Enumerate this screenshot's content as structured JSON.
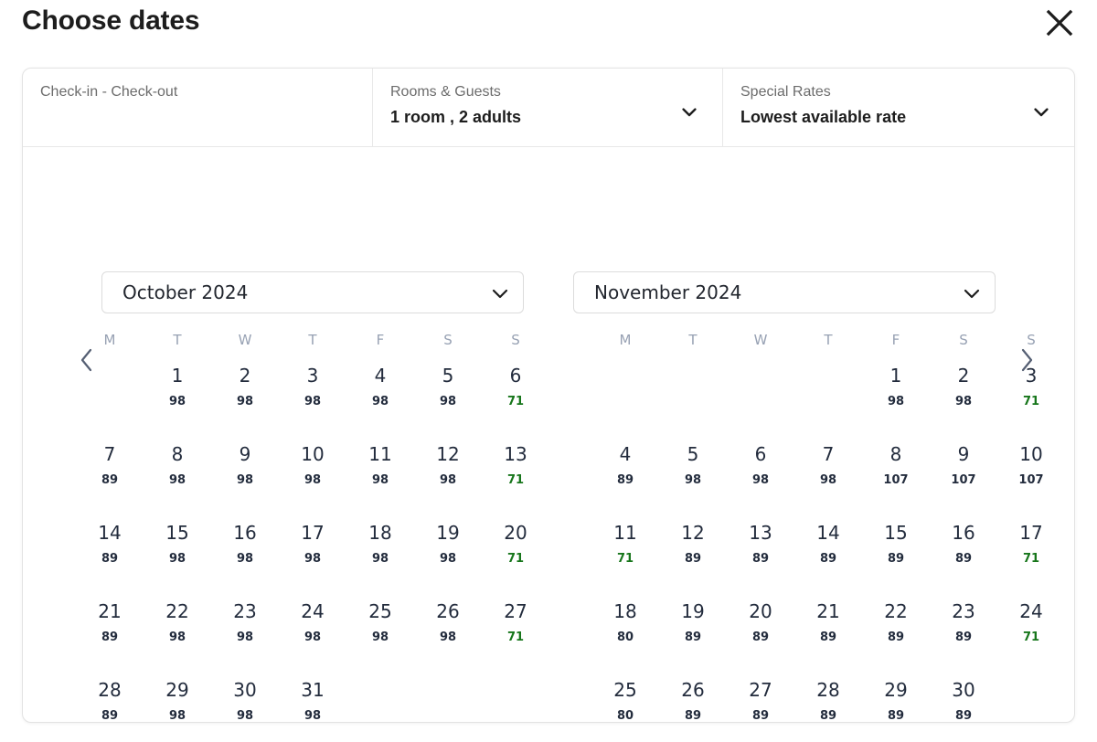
{
  "header": {
    "title": "Choose dates",
    "close_icon": "close-icon"
  },
  "search_bar": {
    "checkin": {
      "label": "Check-in - Check-out",
      "value": ""
    },
    "rooms": {
      "label": "Rooms & Guests",
      "value": "1 room , 2 adults",
      "caret_icon": "chevron-down-icon"
    },
    "rates": {
      "label": "Special Rates",
      "value": "Lowest available rate",
      "caret_icon": "chevron-down-icon"
    }
  },
  "nav": {
    "prev_icon": "chevron-left-icon",
    "next_icon": "chevron-right-icon"
  },
  "colors": {
    "low_price": "#17761b",
    "price": "#232c3d",
    "day_number": "#232c3d",
    "dow_header": "#97a1b3",
    "border": "#e3e3e3",
    "chevron": "#555f73"
  },
  "day_headers": [
    "M",
    "T",
    "W",
    "T",
    "F",
    "S",
    "S"
  ],
  "months": [
    {
      "name": "October 2024",
      "caret_icon": "chevron-down-icon",
      "weeks": [
        [
          {
            "day": "",
            "price": ""
          },
          {
            "day": "1",
            "price": "98",
            "low": false
          },
          {
            "day": "2",
            "price": "98",
            "low": false
          },
          {
            "day": "3",
            "price": "98",
            "low": false
          },
          {
            "day": "4",
            "price": "98",
            "low": false
          },
          {
            "day": "5",
            "price": "98",
            "low": false
          },
          {
            "day": "6",
            "price": "71",
            "low": true
          }
        ],
        [
          {
            "day": "7",
            "price": "89",
            "low": false
          },
          {
            "day": "8",
            "price": "98",
            "low": false
          },
          {
            "day": "9",
            "price": "98",
            "low": false
          },
          {
            "day": "10",
            "price": "98",
            "low": false
          },
          {
            "day": "11",
            "price": "98",
            "low": false
          },
          {
            "day": "12",
            "price": "98",
            "low": false
          },
          {
            "day": "13",
            "price": "71",
            "low": true
          }
        ],
        [
          {
            "day": "14",
            "price": "89",
            "low": false
          },
          {
            "day": "15",
            "price": "98",
            "low": false
          },
          {
            "day": "16",
            "price": "98",
            "low": false
          },
          {
            "day": "17",
            "price": "98",
            "low": false
          },
          {
            "day": "18",
            "price": "98",
            "low": false
          },
          {
            "day": "19",
            "price": "98",
            "low": false
          },
          {
            "day": "20",
            "price": "71",
            "low": true
          }
        ],
        [
          {
            "day": "21",
            "price": "89",
            "low": false
          },
          {
            "day": "22",
            "price": "98",
            "low": false
          },
          {
            "day": "23",
            "price": "98",
            "low": false
          },
          {
            "day": "24",
            "price": "98",
            "low": false
          },
          {
            "day": "25",
            "price": "98",
            "low": false
          },
          {
            "day": "26",
            "price": "98",
            "low": false
          },
          {
            "day": "27",
            "price": "71",
            "low": true
          }
        ],
        [
          {
            "day": "28",
            "price": "89",
            "low": false
          },
          {
            "day": "29",
            "price": "98",
            "low": false
          },
          {
            "day": "30",
            "price": "98",
            "low": false
          },
          {
            "day": "31",
            "price": "98",
            "low": false
          },
          {
            "day": "",
            "price": ""
          },
          {
            "day": "",
            "price": ""
          },
          {
            "day": "",
            "price": ""
          }
        ]
      ]
    },
    {
      "name": "November 2024",
      "caret_icon": "chevron-down-icon",
      "weeks": [
        [
          {
            "day": "",
            "price": ""
          },
          {
            "day": "",
            "price": ""
          },
          {
            "day": "",
            "price": ""
          },
          {
            "day": "",
            "price": ""
          },
          {
            "day": "1",
            "price": "98",
            "low": false
          },
          {
            "day": "2",
            "price": "98",
            "low": false
          },
          {
            "day": "3",
            "price": "71",
            "low": true
          }
        ],
        [
          {
            "day": "4",
            "price": "89",
            "low": false
          },
          {
            "day": "5",
            "price": "98",
            "low": false
          },
          {
            "day": "6",
            "price": "98",
            "low": false
          },
          {
            "day": "7",
            "price": "98",
            "low": false
          },
          {
            "day": "8",
            "price": "107",
            "low": false
          },
          {
            "day": "9",
            "price": "107",
            "low": false
          },
          {
            "day": "10",
            "price": "107",
            "low": false
          }
        ],
        [
          {
            "day": "11",
            "price": "71",
            "low": true
          },
          {
            "day": "12",
            "price": "89",
            "low": false
          },
          {
            "day": "13",
            "price": "89",
            "low": false
          },
          {
            "day": "14",
            "price": "89",
            "low": false
          },
          {
            "day": "15",
            "price": "89",
            "low": false
          },
          {
            "day": "16",
            "price": "89",
            "low": false
          },
          {
            "day": "17",
            "price": "71",
            "low": true
          }
        ],
        [
          {
            "day": "18",
            "price": "80",
            "low": false
          },
          {
            "day": "19",
            "price": "89",
            "low": false
          },
          {
            "day": "20",
            "price": "89",
            "low": false
          },
          {
            "day": "21",
            "price": "89",
            "low": false
          },
          {
            "day": "22",
            "price": "89",
            "low": false
          },
          {
            "day": "23",
            "price": "89",
            "low": false
          },
          {
            "day": "24",
            "price": "71",
            "low": true
          }
        ],
        [
          {
            "day": "25",
            "price": "80",
            "low": false
          },
          {
            "day": "26",
            "price": "89",
            "low": false
          },
          {
            "day": "27",
            "price": "89",
            "low": false
          },
          {
            "day": "28",
            "price": "89",
            "low": false
          },
          {
            "day": "29",
            "price": "89",
            "low": false
          },
          {
            "day": "30",
            "price": "89",
            "low": false
          },
          {
            "day": "",
            "price": ""
          }
        ]
      ]
    }
  ]
}
